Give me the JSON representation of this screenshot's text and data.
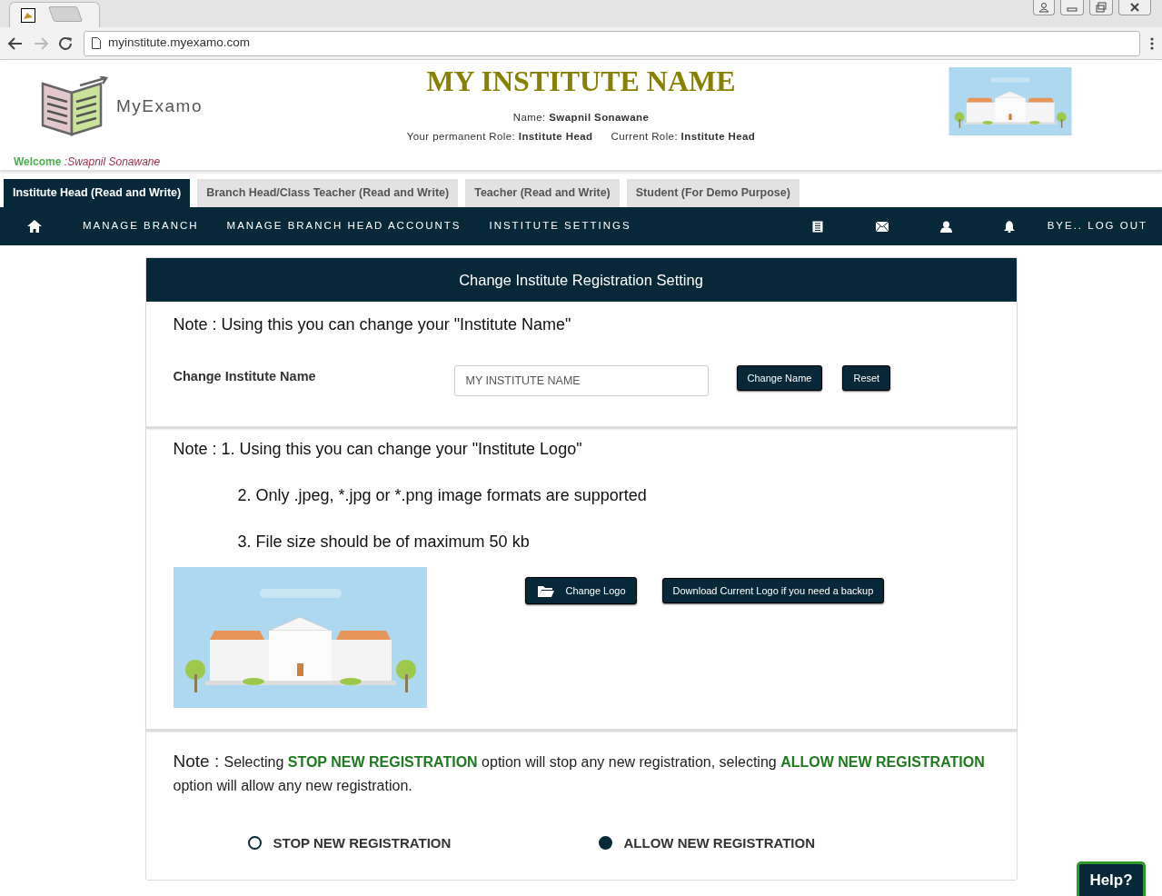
{
  "browser": {
    "url": "myinstitute.myexamo.com"
  },
  "header": {
    "logo_text": "MyExamo",
    "institute_name": "MY INSTITUTE NAME",
    "name_label": "Name:",
    "name_value": "Swapnil Sonawane",
    "permanent_role_label": "Your permanent Role:",
    "permanent_role_value": "Institute Head",
    "current_role_label": "Current Role:",
    "current_role_value": "Institute Head",
    "welcome_label": "Welcome",
    "welcome_name": ":Swapnil Sonawane"
  },
  "role_tabs": [
    {
      "label": "Institute Head (Read and Write)",
      "selected": true
    },
    {
      "label": "Branch Head/Class Teacher (Read and Write)",
      "selected": false
    },
    {
      "label": "Teacher (Read and Write)",
      "selected": false
    },
    {
      "label": "Student (For Demo Purpose)",
      "selected": false
    }
  ],
  "nav": {
    "items": [
      "MANAGE BRANCH",
      "MANAGE BRANCH HEAD ACCOUNTS",
      "INSTITUTE SETTINGS"
    ],
    "logout": "BYE.. LOG OUT"
  },
  "panel": {
    "title": "Change Institute Registration Setting",
    "name_section": {
      "note": "Note : Using this you can change your \"Institute Name\"",
      "label": "Change Institute Name",
      "placeholder": "MY INSTITUTE NAME",
      "buttons": [
        "Change Name",
        "Reset"
      ]
    },
    "logo_section": {
      "notes": [
        "Note : 1. Using this you can change your \"Institute Logo\"",
        "2. Only .jpeg, *.jpg or *.png image formats are supported",
        "3. File size should be of maximum 50 kb"
      ],
      "change_button": "Change Logo",
      "download_button": "Download Current Logo if you need a backup"
    },
    "registration_section": {
      "note_label": "Note :",
      "note": "Selecting **STOP NEW REGISTRATION** option will stop any new registration, selecting **ALLOW NEW REGISTRATION** option will allow any new registration.",
      "options": [
        {
          "label": "STOP NEW REGISTRATION",
          "selected": false
        },
        {
          "label": "ALLOW NEW REGISTRATION",
          "selected": true
        }
      ]
    }
  },
  "help_button": "Help?"
}
